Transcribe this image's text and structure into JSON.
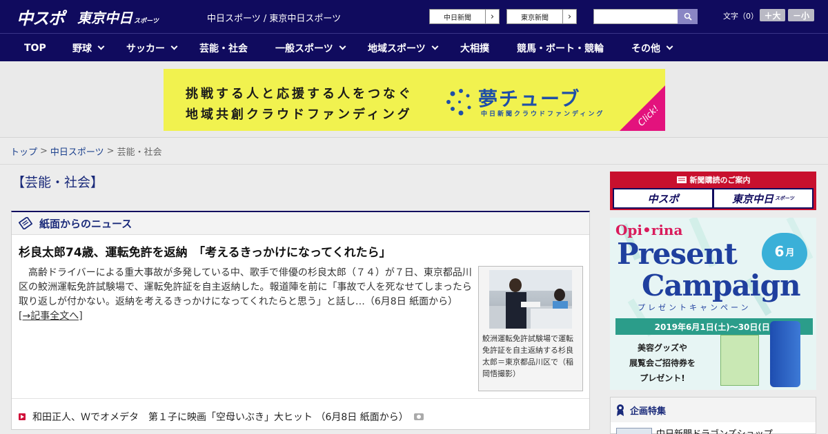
{
  "header": {
    "logo_chunichi": "中スポ",
    "logo_tokyo": "東京中日",
    "logo_tokyo_sub": "スポーツ",
    "site_links": "中日スポーツ / 東京中日スポーツ",
    "paper_buttons": [
      "中日新聞",
      "東京新聞"
    ],
    "search_placeholder": "",
    "font_size_label": "文字（0）",
    "font_bigger": "＋大",
    "font_smaller": "－小"
  },
  "nav": {
    "items": [
      {
        "label": "TOP"
      },
      {
        "label": "野球"
      },
      {
        "label": "サッカー"
      },
      {
        "label": "芸能・社会"
      },
      {
        "label": "一般スポーツ"
      },
      {
        "label": "地域スポーツ"
      },
      {
        "label": "大相撲"
      },
      {
        "label": "競馬・ボート・競輪"
      },
      {
        "label": "その他"
      }
    ]
  },
  "banner": {
    "line1": "挑戦する人と応援する人をつなぐ",
    "line2": "地域共創クラウドファンディング",
    "name": "夢チューブ",
    "sub": "中日新聞クラウドファンディング",
    "click": "Click!"
  },
  "breadcrumb": {
    "top": "トップ",
    "section": "中日スポーツ",
    "current": "芸能・社会",
    "sep": ">"
  },
  "page_heading": "【芸能・社会】",
  "news": {
    "box_title": "紙面からのニュース",
    "headline": "杉良太郎74歳、運転免許を返納　「考えるきっかけになってくれたら」",
    "body": "高齢ドライバーによる重大事故が多発している中、歌手で俳優の杉良太郎（７４）が７日、東京都品川区の鮫洲運転免許試験場で、運転免許証を自主返納した。報道陣を前に「事故で人を死なせてしまったら取り返しが付かない。返納を考えるきっかけになってくれたらと思う」と話し…（6月8日 紙面から）",
    "more": "[→記事全文へ]",
    "photo_caption": "鮫洲運転免許試験場で運転免許証を自主返納する杉良太郎＝東京都品川区で（稲岡悟撮影）",
    "list": [
      {
        "text": "和田正人、Ｗでオメデタ　第１子に映画「空母いぶき」大ヒット （6月8日 紙面から）"
      }
    ]
  },
  "sidebar": {
    "subscribe_header": "新聞購読のご案内",
    "subscribe_chunichi": "中スポ",
    "subscribe_tokyo": "東京中日",
    "subscribe_tokyo_sub": "スポーツ",
    "promo": {
      "brand": "Opi•rina",
      "title1": "Present",
      "title2": "Campaign",
      "month": "6",
      "month_unit": "月",
      "kana": "プレゼントキャンペーン",
      "date": "2019年6月1日(土)〜30日(日)",
      "goods1": "美容グッズや",
      "goods2": "展覧会ご招待券を",
      "goods3": "プレゼント!"
    },
    "special_title": "企画特集",
    "special_item": "中日新聞ドラゴンズショップ"
  },
  "colors": {
    "header_bg": "#100b5e",
    "accent_red": "#c8102e",
    "banner_yellow": "#f1f24f",
    "banner_pink": "#e3127d"
  }
}
